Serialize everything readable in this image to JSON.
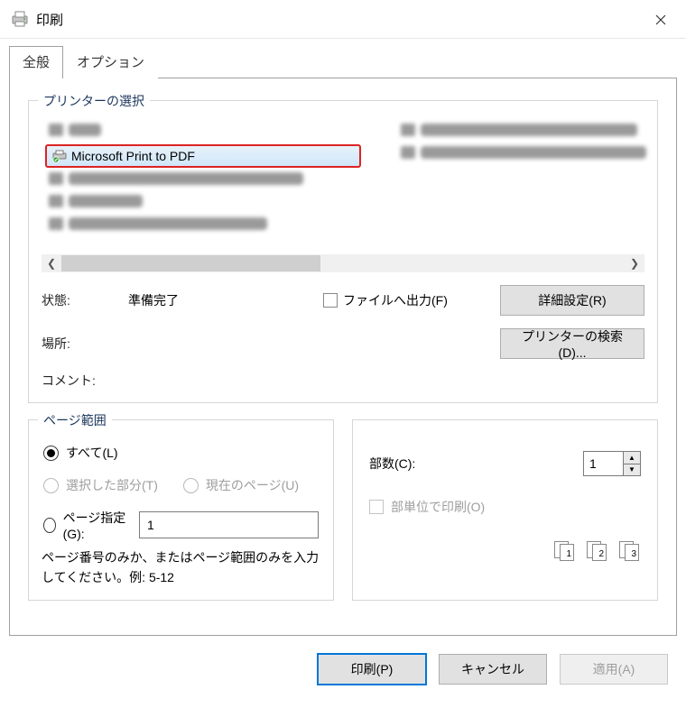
{
  "window": {
    "title": "印刷"
  },
  "tabs": {
    "general": "全般",
    "options": "オプション",
    "active": "general"
  },
  "printer_select": {
    "legend": "プリンターの選択",
    "selected": "Microsoft Print to PDF"
  },
  "status": {
    "state_label": "状態:",
    "state_value": "準備完了",
    "location_label": "場所:",
    "comment_label": "コメント:",
    "output_to_file": "ファイルへ出力(F)",
    "preferences_btn": "詳細設定(R)",
    "find_printer_btn": "プリンターの検索(D)..."
  },
  "page_range": {
    "legend": "ページ範囲",
    "all": "すべて(L)",
    "selection": "選択した部分(T)",
    "current": "現在のページ(U)",
    "pages_label": "ページ指定(G):",
    "pages_value": "1",
    "hint": "ページ番号のみか、またはページ範囲のみを入力してください。例: 5-12"
  },
  "copies": {
    "label": "部数(C):",
    "value": "1",
    "collate_label": "部単位で印刷(O)",
    "stack_digits": [
      "1",
      "2",
      "3"
    ]
  },
  "buttons": {
    "print": "印刷(P)",
    "cancel": "キャンセル",
    "apply": "適用(A)"
  }
}
